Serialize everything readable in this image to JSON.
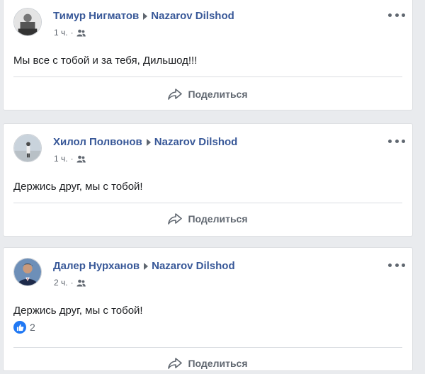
{
  "posts": [
    {
      "author": "Тимур Нигматов",
      "target": "Nazarov Dilshod",
      "time": "1 ч.",
      "privacy_icon": "friends-icon",
      "text": "Мы все с тобой и за тебя, Дильшод!!!",
      "share_label": "Поделиться"
    },
    {
      "author": "Хилол Полвонов",
      "target": "Nazarov Dilshod",
      "time": "1 ч.",
      "privacy_icon": "friends-icon",
      "text": "Держись друг, мы с тобой!",
      "share_label": "Поделиться"
    },
    {
      "author": "Далер Нурханов",
      "target": "Nazarov Dilshod",
      "time": "2 ч.",
      "privacy_icon": "friends-icon",
      "text": "Держись друг, мы с тобой!",
      "like_count": "2",
      "share_label": "Поделиться"
    }
  ],
  "colors": {
    "name": "#385898",
    "like": "#2078f4",
    "meta": "#606770"
  }
}
